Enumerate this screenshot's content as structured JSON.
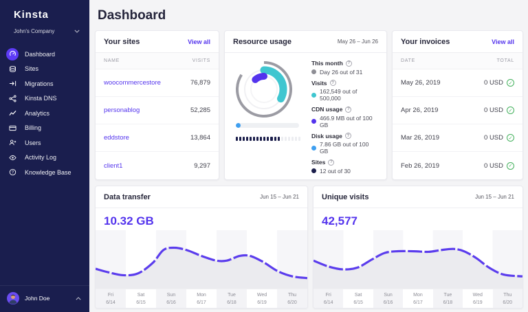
{
  "icons": {
    "help": "?",
    "check": "✓"
  },
  "sidebar": {
    "logo": "Kinsta",
    "company": "John's Company",
    "items": [
      {
        "label": "Dashboard",
        "active": true
      },
      {
        "label": "Sites"
      },
      {
        "label": "Migrations"
      },
      {
        "label": "Kinsta DNS"
      },
      {
        "label": "Analytics"
      },
      {
        "label": "Billing"
      },
      {
        "label": "Users"
      },
      {
        "label": "Activity Log"
      },
      {
        "label": "Knowledge Base"
      }
    ],
    "user": {
      "name": "John Doe"
    }
  },
  "header": {
    "title": "Dashboard"
  },
  "sites_card": {
    "title": "Your sites",
    "view_all": "View all",
    "columns": {
      "name": "NAME",
      "visits": "VISITS"
    },
    "rows": [
      {
        "name": "woocommercestore",
        "visits": "76,879"
      },
      {
        "name": "personablog",
        "visits": "52,285"
      },
      {
        "name": "eddstore",
        "visits": "13,864"
      },
      {
        "name": "client1",
        "visits": "9,297"
      }
    ]
  },
  "resource_card": {
    "title": "Resource usage",
    "range": "May 26 – Jun 26",
    "stats": [
      {
        "label": "This month",
        "value": "Day 26 out of 31",
        "color": "#8e8e95"
      },
      {
        "label": "Visits",
        "value": "162,549 out of 500,000",
        "color": "#3fc6d0"
      },
      {
        "label": "CDN usage",
        "value": "466.9 MB out of 100 GB",
        "color": "#5333ed"
      },
      {
        "label": "Disk usage",
        "value": "7.86 GB out of 100 GB",
        "color": "#3f9ff0"
      },
      {
        "label": "Sites",
        "value": "12 out of 30",
        "color": "#1b1e4b"
      }
    ],
    "donut_display": {
      "month_pct": 84,
      "visits_pct": 33,
      "cdn_deg": 42
    },
    "disk_bar_pct": 8,
    "sites_bar": {
      "filled": 13,
      "total": 19,
      "filled_color": "#1b1e4b",
      "empty_color": "#ecedf1"
    }
  },
  "invoices_card": {
    "title": "Your invoices",
    "view_all": "View all",
    "columns": {
      "date": "DATE",
      "total": "TOTAL"
    },
    "rows": [
      {
        "date": "May 26, 2019",
        "total": "0 USD"
      },
      {
        "date": "Apr 26, 2019",
        "total": "0 USD"
      },
      {
        "date": "Mar 26, 2019",
        "total": "0 USD"
      },
      {
        "date": "Feb 26, 2019",
        "total": "0 USD"
      }
    ]
  },
  "charts": [
    {
      "type": "line",
      "title": "Data transfer",
      "range": "Jun 15 – Jun 21",
      "big_value": "10.32 GB",
      "days": [
        [
          "Fri",
          "6/14"
        ],
        [
          "Sat",
          "6/15"
        ],
        [
          "Sun",
          "6/16"
        ],
        [
          "Mon",
          "6/17"
        ],
        [
          "Tue",
          "6/18"
        ],
        [
          "Wed",
          "6/19"
        ],
        [
          "Thu",
          "6/20"
        ]
      ],
      "points": [
        [
          0,
          0.66
        ],
        [
          0.06,
          0.72
        ],
        [
          0.13,
          0.77
        ],
        [
          0.2,
          0.74
        ],
        [
          0.27,
          0.56
        ],
        [
          0.32,
          0.34
        ],
        [
          0.37,
          0.3
        ],
        [
          0.43,
          0.34
        ],
        [
          0.5,
          0.44
        ],
        [
          0.57,
          0.52
        ],
        [
          0.62,
          0.52
        ],
        [
          0.68,
          0.44
        ],
        [
          0.73,
          0.44
        ],
        [
          0.79,
          0.54
        ],
        [
          0.86,
          0.7
        ],
        [
          0.93,
          0.79
        ],
        [
          1,
          0.82
        ]
      ]
    },
    {
      "type": "line",
      "title": "Unique visits",
      "range": "Jun 15 – Jun 21",
      "big_value": "42,577",
      "days": [
        [
          "Fri",
          "6/14"
        ],
        [
          "Sat",
          "6/15"
        ],
        [
          "Sun",
          "6/16"
        ],
        [
          "Mon",
          "6/17"
        ],
        [
          "Tue",
          "6/18"
        ],
        [
          "Wed",
          "6/19"
        ],
        [
          "Thu",
          "6/20"
        ]
      ],
      "points": [
        [
          0,
          0.52
        ],
        [
          0.07,
          0.62
        ],
        [
          0.14,
          0.67
        ],
        [
          0.21,
          0.64
        ],
        [
          0.28,
          0.5
        ],
        [
          0.34,
          0.39
        ],
        [
          0.4,
          0.36
        ],
        [
          0.48,
          0.36
        ],
        [
          0.55,
          0.37
        ],
        [
          0.61,
          0.34
        ],
        [
          0.67,
          0.32
        ],
        [
          0.72,
          0.36
        ],
        [
          0.78,
          0.48
        ],
        [
          0.84,
          0.64
        ],
        [
          0.91,
          0.76
        ],
        [
          1,
          0.79
        ]
      ]
    }
  ]
}
